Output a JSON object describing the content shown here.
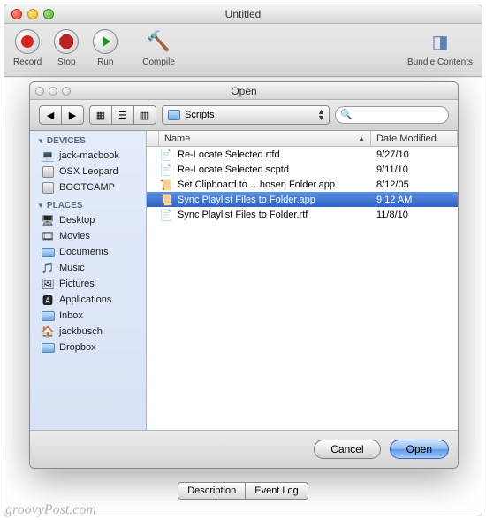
{
  "main_window": {
    "title": "Untitled"
  },
  "toolbar": {
    "record": "Record",
    "stop": "Stop",
    "run": "Run",
    "compile": "Compile",
    "bundle": "Bundle Contents"
  },
  "open_dialog": {
    "title": "Open",
    "folder": "Scripts",
    "search_placeholder": "",
    "columns": {
      "name": "Name",
      "date": "Date Modified"
    },
    "cancel": "Cancel",
    "open": "Open"
  },
  "sidebar": {
    "devices_header": "DEVICES",
    "places_header": "PLACES",
    "devices": [
      {
        "label": "jack-macbook",
        "icon": "💻"
      },
      {
        "label": "OSX Leopard",
        "icon": "drive"
      },
      {
        "label": "BOOTCAMP",
        "icon": "drive"
      }
    ],
    "places": [
      {
        "label": "Desktop",
        "icon": "🖥"
      },
      {
        "label": "Movies",
        "icon": "🎞"
      },
      {
        "label": "Documents",
        "icon": "folder"
      },
      {
        "label": "Music",
        "icon": "🎵"
      },
      {
        "label": "Pictures",
        "icon": "🖼"
      },
      {
        "label": "Applications",
        "icon": "🅰"
      },
      {
        "label": "Inbox",
        "icon": "folder"
      },
      {
        "label": "jackbusch",
        "icon": "🏠"
      },
      {
        "label": "Dropbox",
        "icon": "folder"
      }
    ]
  },
  "files": [
    {
      "name": "Re-Locate Selected.rtfd",
      "date": "9/27/10",
      "icon": "📄",
      "selected": false
    },
    {
      "name": "Re-Locate Selected.scptd",
      "date": "9/11/10",
      "icon": "📄",
      "selected": false
    },
    {
      "name": "Set Clipboard to …hosen Folder.app",
      "date": "8/12/05",
      "icon": "📜",
      "selected": false
    },
    {
      "name": "Sync Playlist Files to Folder.app",
      "date": "9:12 AM",
      "icon": "📜",
      "selected": true
    },
    {
      "name": "Sync Playlist Files to Folder.rtf",
      "date": "11/8/10",
      "icon": "📄",
      "selected": false
    }
  ],
  "bottom_tabs": {
    "description": "Description",
    "event_log": "Event Log"
  },
  "watermark": "groovyPost.com"
}
